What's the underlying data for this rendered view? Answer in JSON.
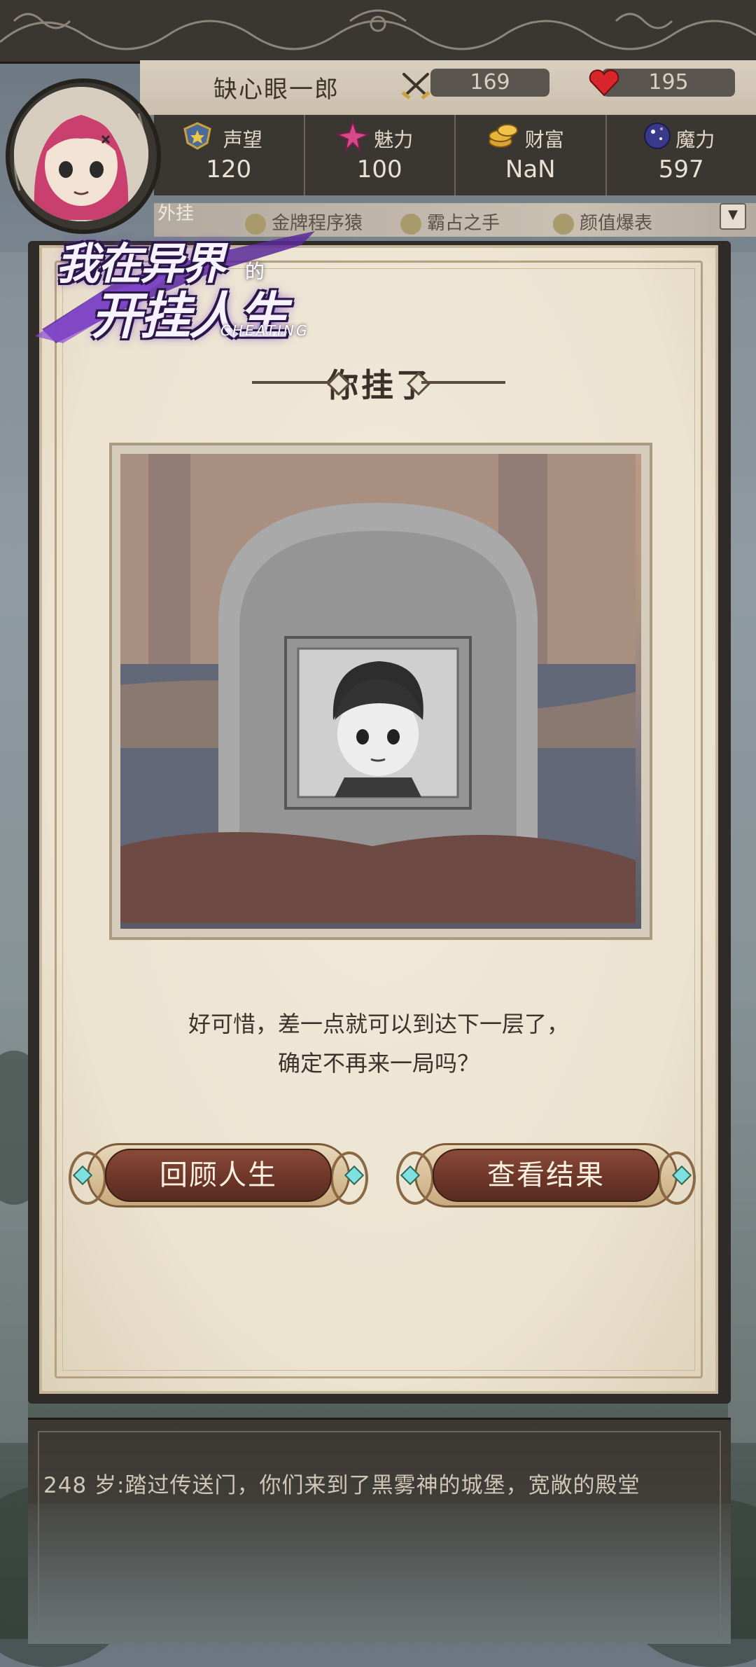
{
  "player": {
    "name": "缺心眼一郎",
    "attack": "169",
    "hp": "195"
  },
  "stats": [
    {
      "label": "声望",
      "value": "120",
      "icon": "reputation-icon"
    },
    {
      "label": "魅力",
      "value": "100",
      "icon": "charm-icon"
    },
    {
      "label": "财富",
      "value": "NaN",
      "icon": "wealth-icon"
    },
    {
      "label": "魔力",
      "value": "597",
      "icon": "magic-icon"
    }
  ],
  "cheats": {
    "tag": "外挂",
    "items": [
      "金牌程序猿",
      "霸占之手",
      "颜值爆表"
    ]
  },
  "logo": {
    "line1": "我在异界",
    "de": "的",
    "line2": "开挂人生",
    "sub": "CHEATING"
  },
  "dialog": {
    "title": "你挂了",
    "message_line1": "好可惜，差一点就可以到达下一层了，",
    "message_line2": "确定不再来一局吗？",
    "review_button": "回顾人生",
    "result_button": "查看结果"
  },
  "log": {
    "entry": "248 岁:踏过传送门，你们来到了黑雾神的城堡，宽敞的殿堂"
  },
  "colors": {
    "hud_dark": "#3a3631",
    "parchment": "#ebe2cf",
    "button_red": "#6b3528",
    "hp_red": "#d8262a"
  }
}
